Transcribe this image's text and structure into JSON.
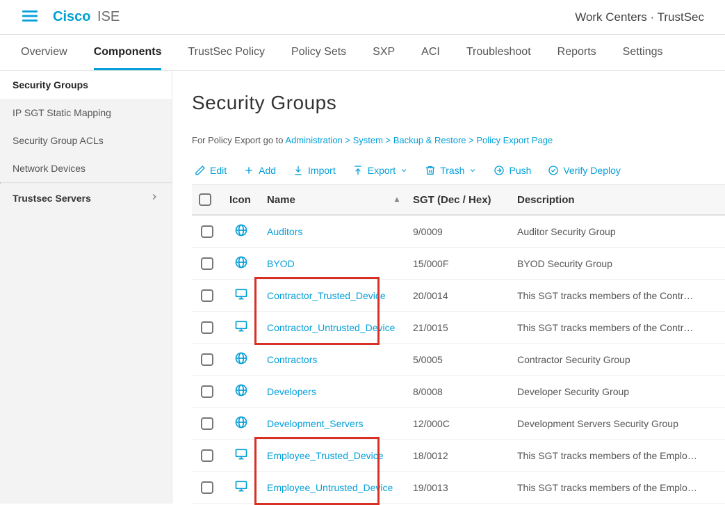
{
  "brand": {
    "cisco": "Cisco",
    "ise": "ISE"
  },
  "breadcrumb": "Work Centers · TrustSec",
  "nav": [
    {
      "label": "Overview"
    },
    {
      "label": "Components"
    },
    {
      "label": "TrustSec Policy"
    },
    {
      "label": "Policy Sets"
    },
    {
      "label": "SXP"
    },
    {
      "label": "ACI"
    },
    {
      "label": "Troubleshoot"
    },
    {
      "label": "Reports"
    },
    {
      "label": "Settings"
    }
  ],
  "nav_active": 1,
  "sidebar": {
    "items": [
      {
        "label": "Security Groups",
        "active": true
      },
      {
        "label": "IP SGT Static Mapping"
      },
      {
        "label": "Security Group ACLs"
      },
      {
        "label": "Network Devices"
      }
    ],
    "expand": {
      "label": "Trustsec Servers"
    }
  },
  "page": {
    "title": "Security Groups",
    "export_note_prefix": "For Policy Export go to ",
    "export_note_link": "Administration > System > Backup & Restore > Policy Export Page"
  },
  "toolbar": {
    "edit": "Edit",
    "add": "Add",
    "import": "Import",
    "export": "Export",
    "trash": "Trash",
    "push": "Push",
    "verify": "Verify Deploy"
  },
  "table": {
    "headers": {
      "icon": "Icon",
      "name": "Name",
      "sgt": "SGT (Dec / Hex)",
      "desc": "Description"
    },
    "rows": [
      {
        "icon": "globe",
        "name": "Auditors",
        "sgt": "9/0009",
        "desc": "Auditor Security Group"
      },
      {
        "icon": "globe",
        "name": "BYOD",
        "sgt": "15/000F",
        "desc": "BYOD Security Group"
      },
      {
        "icon": "monitor",
        "name": "Contractor_Trusted_Device",
        "sgt": "20/0014",
        "desc": "This SGT tracks members of the Contr…",
        "hl": "top"
      },
      {
        "icon": "monitor",
        "name": "Contractor_Untrusted_Device",
        "sgt": "21/0015",
        "desc": "This SGT tracks members of the Contr…",
        "hl": "bottom"
      },
      {
        "icon": "globe",
        "name": "Contractors",
        "sgt": "5/0005",
        "desc": "Contractor Security Group"
      },
      {
        "icon": "globe",
        "name": "Developers",
        "sgt": "8/0008",
        "desc": "Developer Security Group"
      },
      {
        "icon": "globe",
        "name": "Development_Servers",
        "sgt": "12/000C",
        "desc": "Development Servers Security Group"
      },
      {
        "icon": "monitor",
        "name": "Employee_Trusted_Device",
        "sgt": "18/0012",
        "desc": "This SGT tracks members of the Emplo…",
        "hl": "top"
      },
      {
        "icon": "monitor",
        "name": "Employee_Untrusted_Device",
        "sgt": "19/0013",
        "desc": "This SGT tracks members of the Emplo…",
        "hl": "bottom"
      }
    ]
  }
}
